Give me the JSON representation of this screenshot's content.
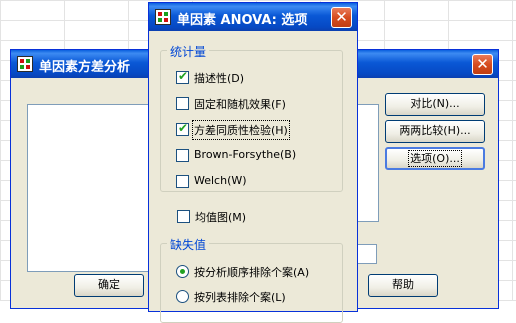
{
  "main_dialog": {
    "title": "单因素方差分析",
    "buttons": {
      "contrasts": "对比(N)...",
      "post_hoc": "两两比较(H)...",
      "options": "选项(O)..."
    },
    "bottom_buttons": {
      "ok": "确定",
      "help": "帮助"
    }
  },
  "options_dialog": {
    "title": "单因素 ANOVA: 选项",
    "statistics": {
      "title": "统计量",
      "items": [
        {
          "label": "描述性(D)",
          "checked": true
        },
        {
          "label": "固定和随机效果(F)",
          "checked": false
        },
        {
          "label": "方差同质性检验(H)",
          "checked": true
        },
        {
          "label": "Brown-Forsythe(B)",
          "checked": false
        },
        {
          "label": "Welch(W)",
          "checked": false
        }
      ]
    },
    "means_plot": {
      "label": "均值图(M)",
      "checked": false
    },
    "missing": {
      "title": "缺失值",
      "items": [
        {
          "label": "按分析顺序排除个案(A)",
          "selected": true
        },
        {
          "label": "按列表排除个案(L)",
          "selected": false
        }
      ]
    }
  }
}
